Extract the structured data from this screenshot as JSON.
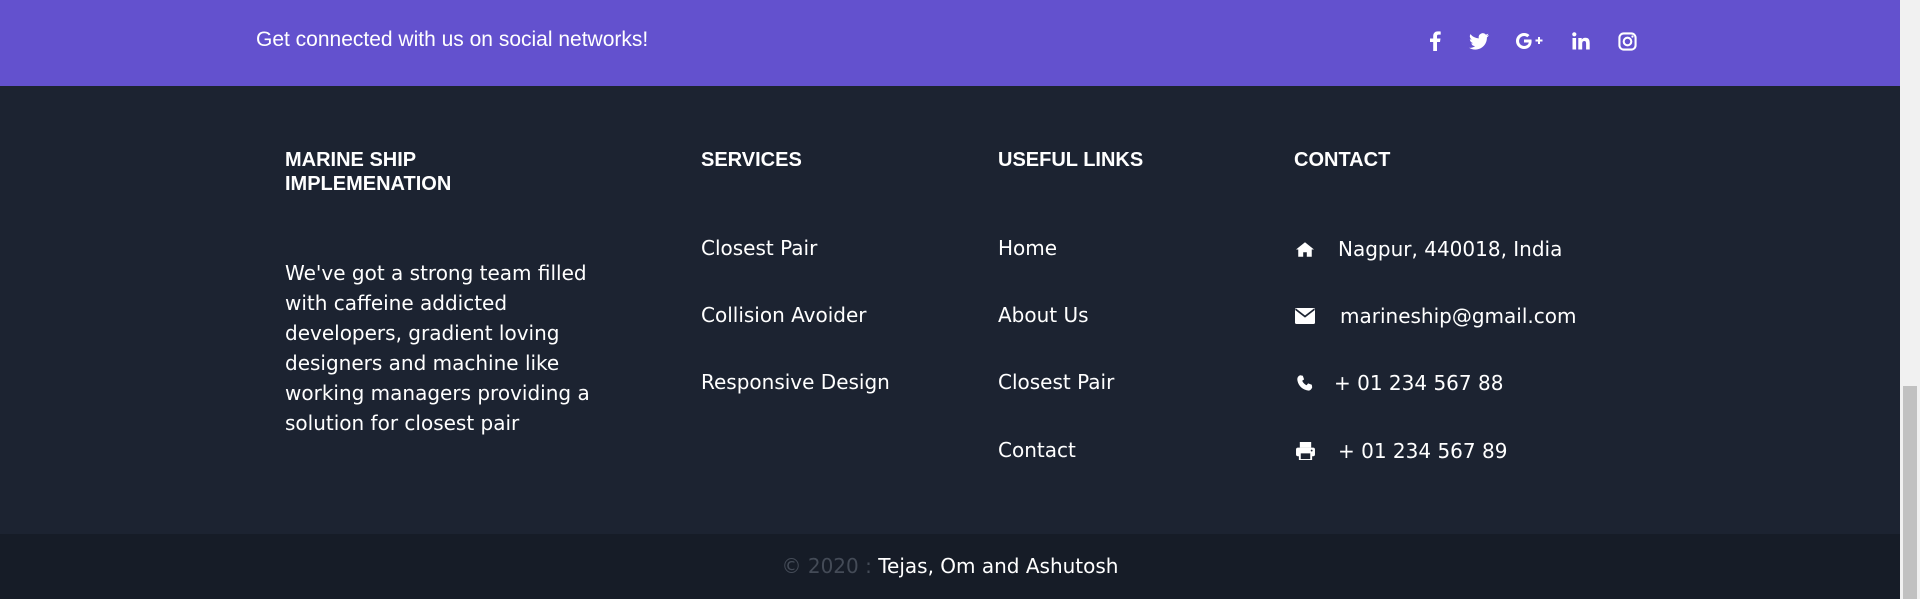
{
  "social": {
    "text": "Get connected with us on social networks!",
    "icons": [
      "facebook-icon",
      "twitter-icon",
      "google-plus-icon",
      "linkedin-icon",
      "instagram-icon"
    ]
  },
  "about": {
    "title": "MARINE SHIP IMPLEMENATION",
    "text": "We've got a strong team filled with caffeine addicted developers, gradient loving designers and machine like working managers providing a solution for closest pair"
  },
  "services": {
    "title": "SERVICES",
    "items": [
      "Closest Pair",
      "Collision Avoider",
      "Responsive Design"
    ]
  },
  "useful_links": {
    "title": "USEFUL LINKS",
    "items": [
      "Home",
      "About Us",
      "Closest Pair",
      "Contact"
    ]
  },
  "contact": {
    "title": "CONTACT",
    "address": "Nagpur, 440018, India",
    "email": "marineship@gmail.com",
    "phone": "+ 01 234 567 88",
    "fax": "+ 01 234 567 89",
    "icons": [
      "home-icon",
      "envelope-icon",
      "phone-icon",
      "print-icon"
    ]
  },
  "copyright": {
    "prefix": "© 2020 :",
    "authors": "Tejas, Om and Ashutosh"
  },
  "colors": {
    "social_bar": "#6351ce",
    "footer_bg": "#1c2331",
    "copyright_bg": "#161c27"
  }
}
